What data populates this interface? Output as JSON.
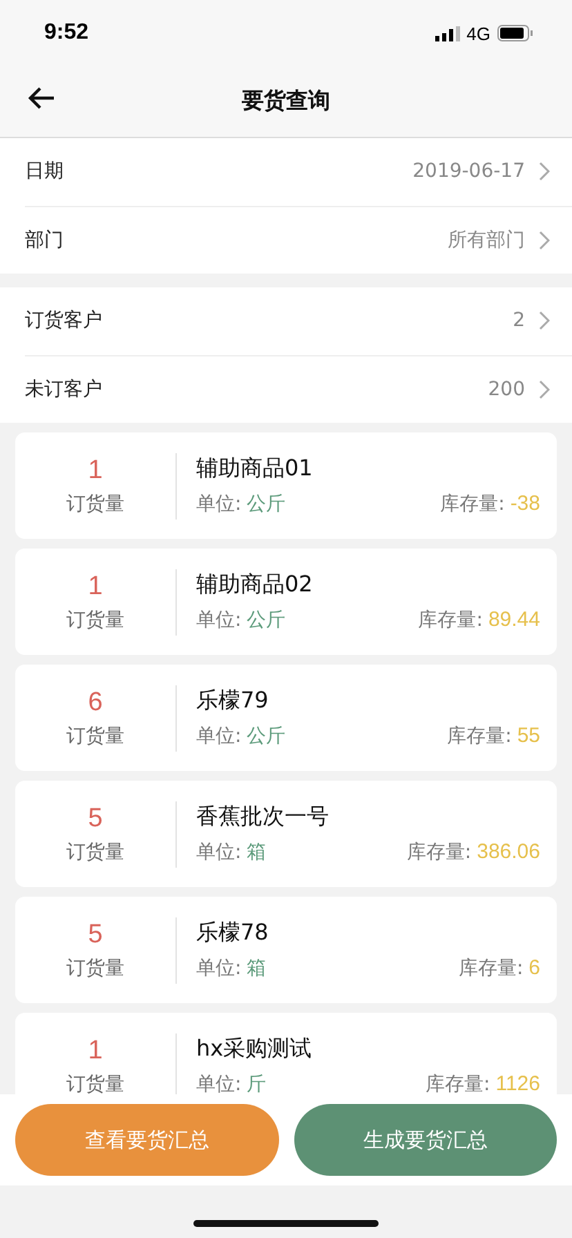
{
  "status_bar": {
    "time": "9:52",
    "network": "4G"
  },
  "nav": {
    "title": "要货查询"
  },
  "filters": [
    {
      "label": "日期",
      "value": "2019-06-17"
    },
    {
      "label": "部门",
      "value": "所有部门"
    }
  ],
  "customers": [
    {
      "label": "订货客户",
      "value": "2"
    },
    {
      "label": "未订客户",
      "value": "200"
    }
  ],
  "items": [
    {
      "qty": "1",
      "qty_label": "订货量",
      "name": "辅助商品01",
      "unit_label": "单位:",
      "unit": "公斤",
      "stock_label": "库存量:",
      "stock": "-38"
    },
    {
      "qty": "1",
      "qty_label": "订货量",
      "name": "辅助商品02",
      "unit_label": "单位:",
      "unit": "公斤",
      "stock_label": "库存量:",
      "stock": "89.44"
    },
    {
      "qty": "6",
      "qty_label": "订货量",
      "name": "乐檬79",
      "unit_label": "单位:",
      "unit": "公斤",
      "stock_label": "库存量:",
      "stock": "55"
    },
    {
      "qty": "5",
      "qty_label": "订货量",
      "name": "香蕉批次一号",
      "unit_label": "单位:",
      "unit": "箱",
      "stock_label": "库存量:",
      "stock": "386.06"
    },
    {
      "qty": "5",
      "qty_label": "订货量",
      "name": "乐檬78",
      "unit_label": "单位:",
      "unit": "箱",
      "stock_label": "库存量:",
      "stock": "6"
    },
    {
      "qty": "1",
      "qty_label": "订货量",
      "name": "hx采购测试",
      "unit_label": "单位:",
      "unit": "斤",
      "stock_label": "库存量:",
      "stock": "1126"
    }
  ],
  "buttons": [
    {
      "label": "查看要货汇总",
      "kind": "secondary"
    },
    {
      "label": "生成要货汇总",
      "kind": "primary"
    }
  ]
}
